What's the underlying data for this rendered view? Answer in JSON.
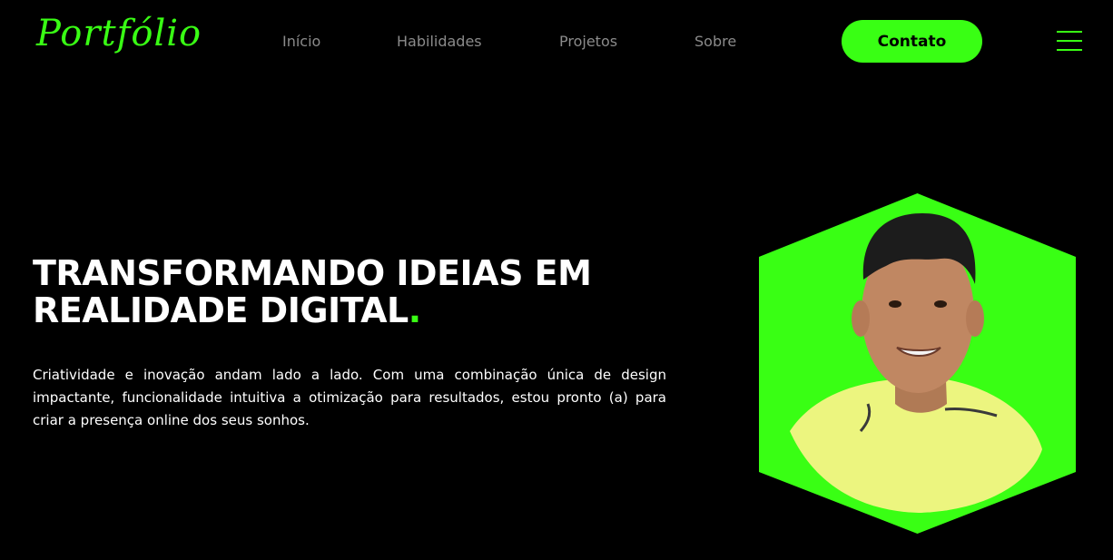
{
  "header": {
    "logo_text": "Portfólio",
    "nav": [
      {
        "label": "Início"
      },
      {
        "label": "Habilidades"
      },
      {
        "label": "Projetos"
      },
      {
        "label": "Sobre"
      }
    ],
    "contact_label": "Contato",
    "menu_icon": "hamburger-menu-icon"
  },
  "hero": {
    "title_line1": "TRANSFORMANDO IDEIAS EM",
    "title_line2": "REALIDADE DIGITAL",
    "title_dot": ".",
    "description": "Criatividade e inovação andam lado a lado. Com uma combinação única de design impactante, funcionalidade intuitiva a otimização para resultados, estou pronto (a) para criar a presença online dos seus sonhos."
  },
  "colors": {
    "accent": "#39ff14",
    "background": "#000000",
    "nav_text": "#8b8b8b",
    "text": "#ffffff"
  }
}
